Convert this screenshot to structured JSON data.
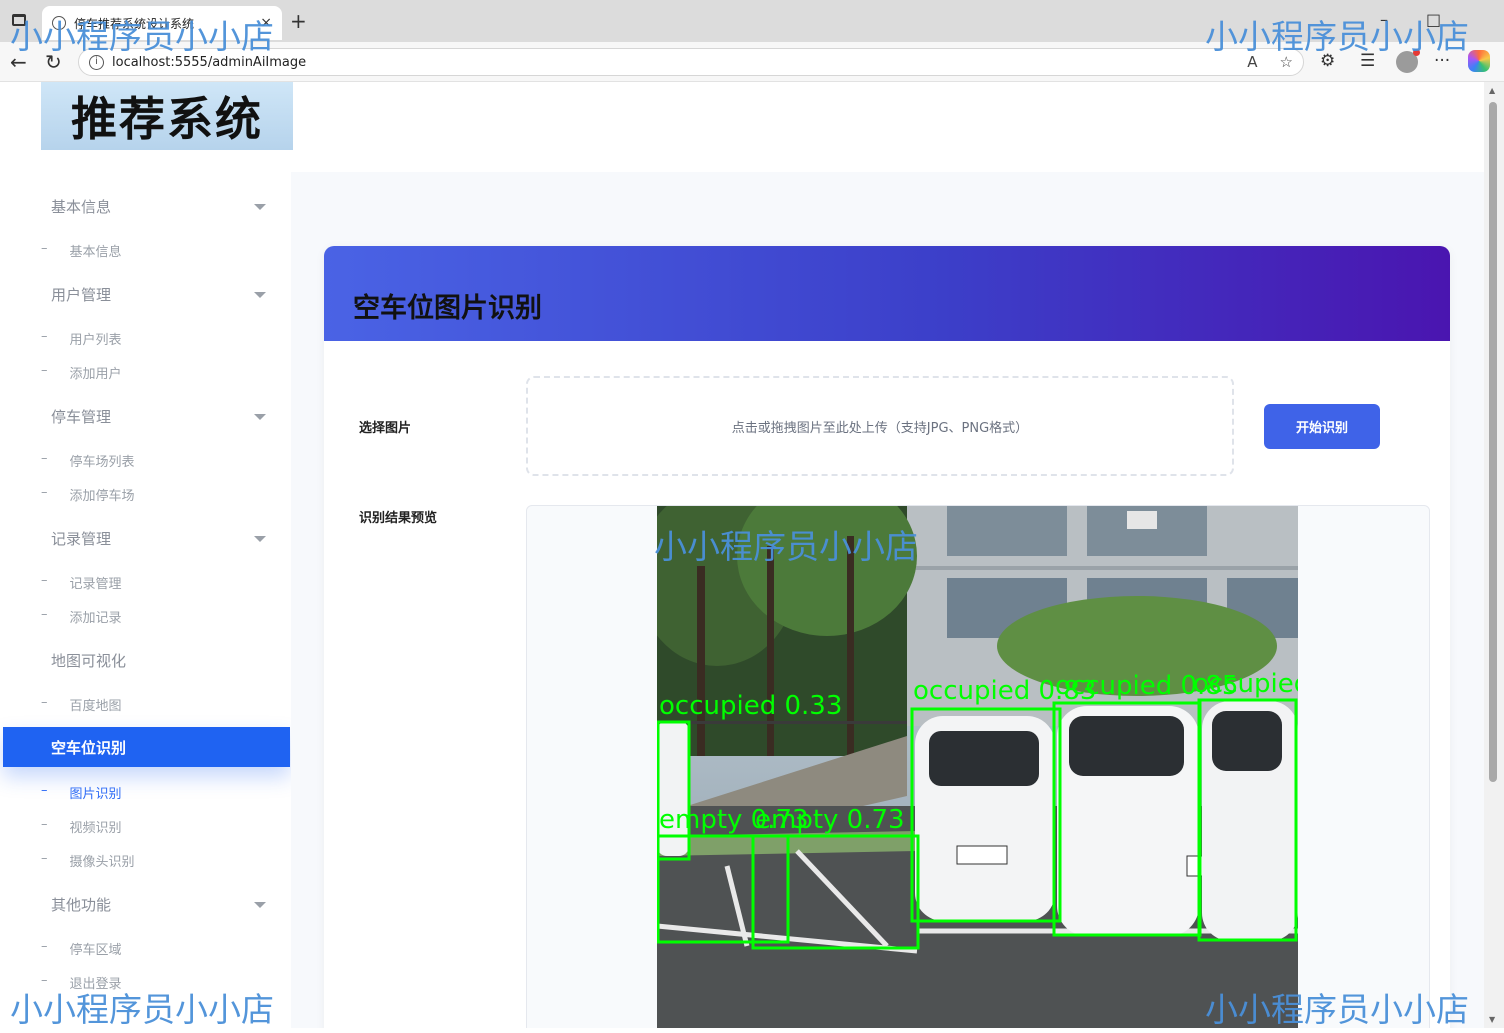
{
  "browser": {
    "tab_title": "停车推荐系统设计系统",
    "url": "localhost:5555/adminAiImage"
  },
  "logo": {
    "text": "推荐系统"
  },
  "sidebar": {
    "groups": [
      {
        "label": "基本信息",
        "items": [
          "基本信息"
        ]
      },
      {
        "label": "用户管理",
        "items": [
          "用户列表",
          "添加用户"
        ]
      },
      {
        "label": "停车管理",
        "items": [
          "停车场列表",
          "添加停车场"
        ]
      },
      {
        "label": "记录管理",
        "items": [
          "记录管理",
          "添加记录"
        ]
      },
      {
        "label": "地图可视化",
        "items": [
          "百度地图"
        ]
      },
      {
        "label": "空车位识别",
        "items": [
          "图片识别",
          "视频识别",
          "摄像头识别"
        ]
      },
      {
        "label": "其他功能",
        "items": [
          "停车区域",
          "退出登录"
        ]
      }
    ],
    "active_item": "图片识别"
  },
  "card": {
    "title": "空车位图片识别",
    "select_label": "选择图片",
    "upload_hint": "点击或拖拽图片至此处上传（支持JPG、PNG格式）",
    "start_button": "开始识别",
    "preview_label": "识别结果预览"
  },
  "detections": [
    {
      "label": "occupied 0.33"
    },
    {
      "label": "occupied 0.83"
    },
    {
      "label": "occupied 0.85"
    },
    {
      "label": "occupied"
    },
    {
      "label": "empty 0.73"
    },
    {
      "label": "empty 0.73"
    }
  ],
  "watermark": "小小程序员小小店",
  "colors": {
    "accent": "#1f63f2",
    "button": "#3f63e8",
    "header_start": "#4a63e5",
    "header_end": "#4a15b0",
    "detection": "#00ff00",
    "watermark": "#4a90d9"
  }
}
